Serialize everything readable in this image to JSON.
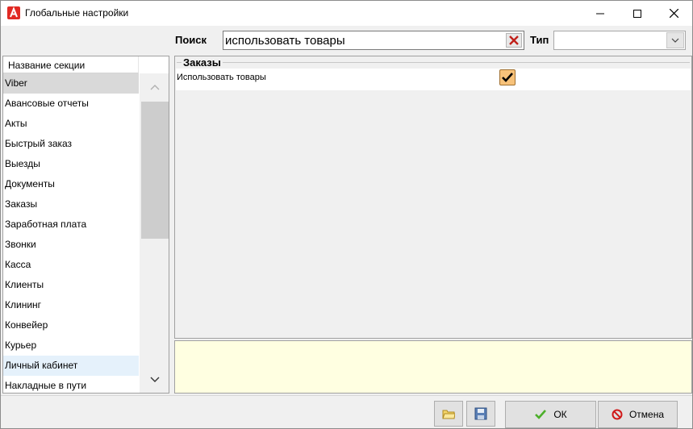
{
  "window": {
    "title": "Глобальные настройки",
    "icon": "app-logo-icon",
    "controls": [
      "minimize-icon",
      "maximize-icon",
      "close-icon"
    ]
  },
  "search": {
    "label": "Поиск",
    "value": "использовать товары",
    "clear_icon": "clear-x-icon"
  },
  "type_filter": {
    "label": "Тип",
    "value": ""
  },
  "sections": {
    "header": "Название секции",
    "items": [
      "Viber",
      "Авансовые отчеты",
      "Акты",
      "Быстрый заказ",
      "Выезды",
      "Документы",
      "Заказы",
      "Заработная плата",
      "Звонки",
      "Касса",
      "Клиенты",
      "Клининг",
      "Конвейер",
      "Курьер",
      "Личный кабинет",
      "Накладные в пути"
    ],
    "selected_index": 0,
    "hover_index": 14
  },
  "settings": {
    "group_title": "Заказы",
    "rows": [
      {
        "label": "Использовать товары",
        "checked": true
      }
    ]
  },
  "description": "",
  "footer": {
    "open_icon": "folder-icon",
    "save_icon": "floppy-disk-icon",
    "ok_label": "ОК",
    "cancel_label": "Отмена"
  },
  "colors": {
    "description_bg": "#ffffe1",
    "checkbox_fill": "#f7c27a",
    "selection": "#d9d9d9",
    "hover": "#e5f1fb",
    "app_icon": "#e12a24"
  }
}
